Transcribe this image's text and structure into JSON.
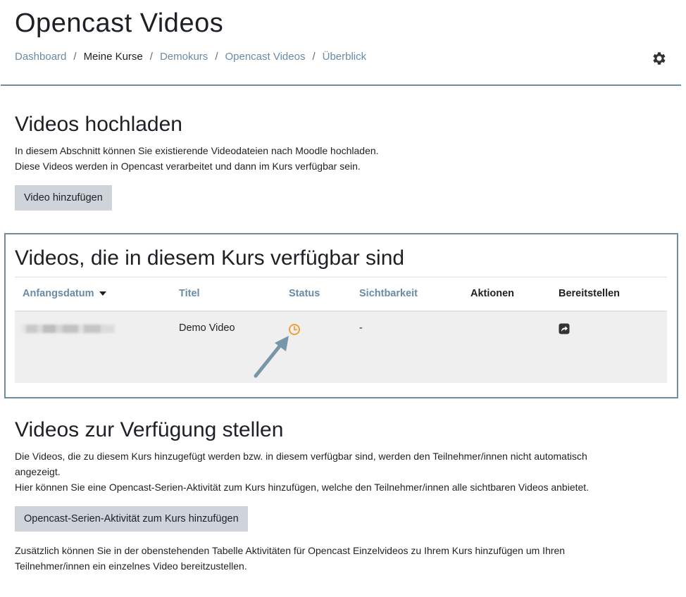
{
  "header": {
    "title": "Opencast Videos",
    "breadcrumb": [
      "Dashboard",
      "Meine Kurse",
      "Demokurs",
      "Opencast Videos",
      "Überblick"
    ],
    "separator": "/",
    "settings_icon": "gear-icon"
  },
  "upload": {
    "heading": "Videos hochladen",
    "line1": "In diesem Abschnitt können Sie existierende Videodateien nach Moodle hochladen.",
    "line2": "Diese Videos werden in Opencast verarbeitet und dann im Kurs verfügbar sein.",
    "button": "Video hinzufügen"
  },
  "available": {
    "heading": "Videos, die in diesem Kurs verfügbar sind",
    "columns": [
      "Anfangsdatum",
      "Titel",
      "Status",
      "Sichtbarkeit",
      "Aktionen",
      "Bereitstellen"
    ],
    "rows": [
      {
        "date": "",
        "title": "Demo Video",
        "status_icon": "clock-icon",
        "visibility": "-",
        "actions": "",
        "provide_icon": "share-icon"
      }
    ],
    "colors": {
      "link": "#6a8ba5",
      "status": "#f0a030",
      "highlight": "#6e8da0"
    }
  },
  "provide": {
    "heading": "Videos zur Verfügung stellen",
    "line1": "Die Videos, die zu diesem Kurs hinzugefügt werden bzw. in diesem verfügbar sind, werden den Teilnehmer/innen nicht automatisch",
    "line2": "angezeigt.",
    "line3": "Hier können Sie eine Opencast-Serien-Aktivität zum Kurs hinzufügen, welche den Teilnehmer/innen alle sichtbaren Videos anbietet.",
    "button": "Opencast-Serien-Aktivität zum Kurs hinzufügen",
    "note1": "Zusätzlich können Sie in der obenstehenden Tabelle Aktivitäten für Opencast Einzelvideos zu Ihrem Kurs hinzufügen um Ihren",
    "note2": "Teilnehmer/innen ein einzelnes Video bereitzustellen."
  }
}
